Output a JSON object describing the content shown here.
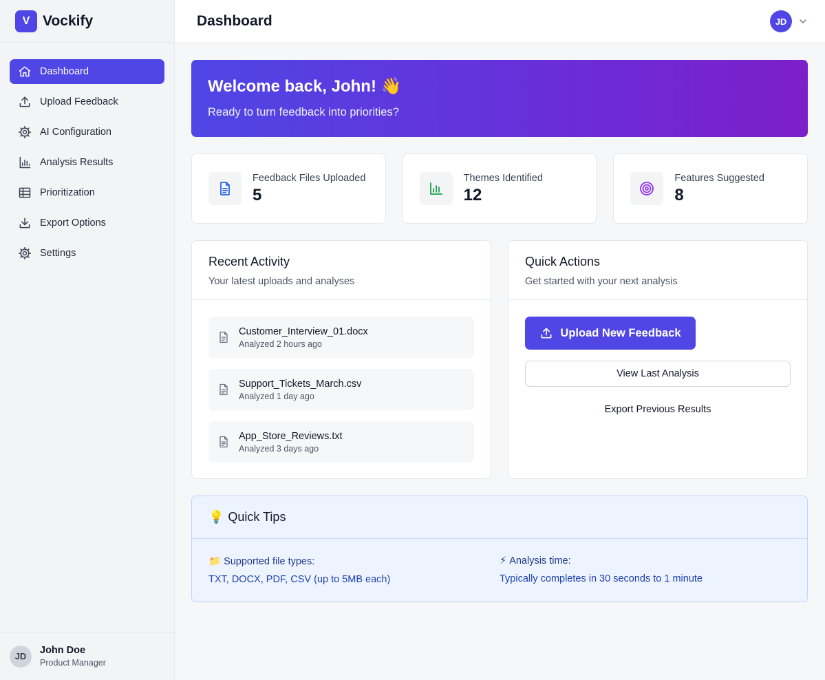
{
  "brand": {
    "logo_letter": "V",
    "name": "Vockify"
  },
  "sidebar": {
    "items": [
      {
        "label": "Dashboard",
        "icon": "home-icon",
        "active": true
      },
      {
        "label": "Upload Feedback",
        "icon": "upload-icon"
      },
      {
        "label": "AI Configuration",
        "icon": "gear-icon"
      },
      {
        "label": "Analysis Results",
        "icon": "bar-chart-icon"
      },
      {
        "label": "Prioritization",
        "icon": "table-icon"
      },
      {
        "label": "Export Options",
        "icon": "download-icon"
      },
      {
        "label": "Settings",
        "icon": "gear-icon"
      }
    ],
    "user": {
      "initials": "JD",
      "name": "John Doe",
      "role": "Product Manager"
    }
  },
  "header": {
    "title": "Dashboard",
    "user_initials": "JD"
  },
  "welcome": {
    "title": "Welcome back, John! 👋",
    "subtitle": "Ready to turn feedback into priorities?"
  },
  "stats": [
    {
      "label": "Feedback Files Uploaded",
      "value": "5",
      "icon": "document-icon",
      "color": "#2563eb"
    },
    {
      "label": "Themes Identified",
      "value": "12",
      "icon": "bar-chart-icon",
      "color": "#16a34a"
    },
    {
      "label": "Features Suggested",
      "value": "8",
      "icon": "target-icon",
      "color": "#9333ea"
    }
  ],
  "activity": {
    "title": "Recent Activity",
    "subtitle": "Your latest uploads and analyses",
    "items": [
      {
        "name": "Customer_Interview_01.docx",
        "time": "Analyzed 2 hours ago"
      },
      {
        "name": "Support_Tickets_March.csv",
        "time": "Analyzed 1 day ago"
      },
      {
        "name": "App_Store_Reviews.txt",
        "time": "Analyzed 3 days ago"
      }
    ]
  },
  "quick_actions": {
    "title": "Quick Actions",
    "subtitle": "Get started with your next analysis",
    "primary_label": "Upload New Feedback",
    "secondary_label": "View Last Analysis",
    "tertiary_label": "Export Previous Results"
  },
  "tips": {
    "title": "Quick Tips",
    "title_emoji": "💡",
    "items": [
      {
        "emoji": "📁",
        "title": "Supported file types:",
        "text": "TXT, DOCX, PDF, CSV (up to 5MB each)"
      },
      {
        "emoji": "⚡",
        "title": "Analysis time:",
        "text": "Typically completes in 30 seconds to 1 minute"
      }
    ]
  },
  "colors": {
    "accent": "#4f46e5",
    "gradient_end": "#7c1fc9"
  }
}
